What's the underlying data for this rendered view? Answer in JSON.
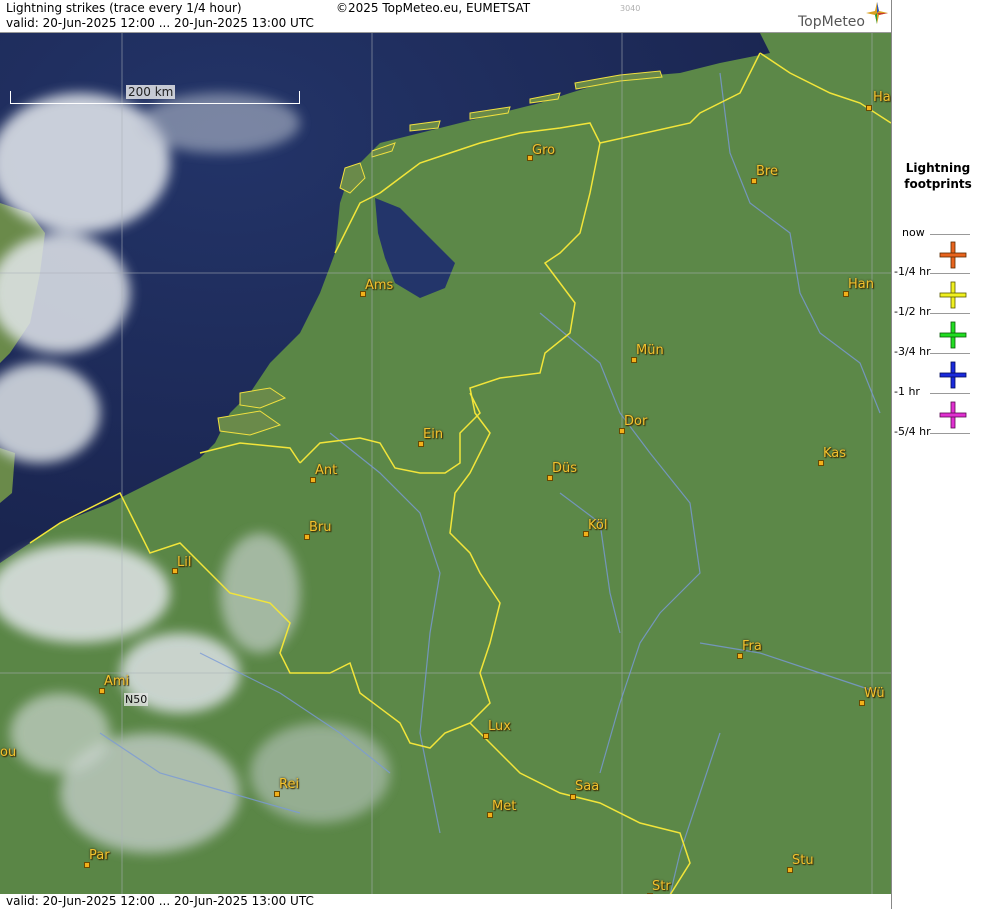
{
  "header": {
    "title": "Lightning strikes (trace every 1/4 hour)",
    "copyright": "©2025 TopMeteo.eu, EUMETSAT",
    "code": "3040",
    "valid": "valid:  20-Jun-2025 12:00 ... 20-Jun-2025 13:00 UTC",
    "brand": "TopMeteo"
  },
  "footer": {
    "valid": "valid:  20-Jun-2025 12:00 ... 20-Jun-2025 13:00 UTC"
  },
  "map": {
    "scale_label": "200 km",
    "lat_label": "N50",
    "cities": [
      {
        "name": "Gro"
      },
      {
        "name": "Bre"
      },
      {
        "name": "Ha"
      },
      {
        "name": "Ams"
      },
      {
        "name": "Han"
      },
      {
        "name": "Mün"
      },
      {
        "name": "Dor"
      },
      {
        "name": "Ein"
      },
      {
        "name": "Kas"
      },
      {
        "name": "Ant"
      },
      {
        "name": "Düs"
      },
      {
        "name": "Bru"
      },
      {
        "name": "Köl"
      },
      {
        "name": "Lil"
      },
      {
        "name": "Fra"
      },
      {
        "name": "Ami"
      },
      {
        "name": "Wü"
      },
      {
        "name": "Lux"
      },
      {
        "name": "ou"
      },
      {
        "name": "Rei"
      },
      {
        "name": "Saa"
      },
      {
        "name": "Met"
      },
      {
        "name": "Par"
      },
      {
        "name": "Stu"
      },
      {
        "name": "Str"
      }
    ]
  },
  "legend": {
    "title_line1": "Lightning",
    "title_line2": "footprints",
    "items": [
      {
        "label": "now",
        "color": "#e8641e"
      },
      {
        "label": "-1/4 hr",
        "color": "#f0f020"
      },
      {
        "label": "-1/2 hr",
        "color": "#22dd22"
      },
      {
        "label": "-3/4 hr",
        "color": "#1a2adc"
      },
      {
        "label": "-1 hr",
        "color": "#e030d0"
      },
      {
        "label": "-5/4 hr",
        "color": ""
      }
    ]
  }
}
